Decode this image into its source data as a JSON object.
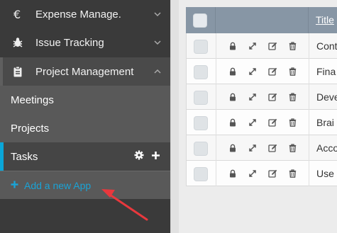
{
  "sidebar": {
    "items": [
      {
        "label": "Expense Manage.",
        "icon": "euro-icon"
      },
      {
        "label": "Issue Tracking",
        "icon": "bug-icon"
      },
      {
        "label": "Project Management",
        "icon": "clipboard-icon"
      }
    ],
    "subitems": [
      {
        "label": "Meetings"
      },
      {
        "label": "Projects"
      },
      {
        "label": "Tasks"
      }
    ],
    "add_app_label": "Add a new App"
  },
  "table": {
    "header_title": "Title",
    "rows": [
      {
        "title": "Cont"
      },
      {
        "title": "Fina"
      },
      {
        "title": "Deve"
      },
      {
        "title": "Brai"
      },
      {
        "title": "Acco"
      },
      {
        "title": "Use C"
      }
    ]
  },
  "colors": {
    "accent": "#0aa6d8",
    "annotation_arrow": "#e8383d"
  }
}
